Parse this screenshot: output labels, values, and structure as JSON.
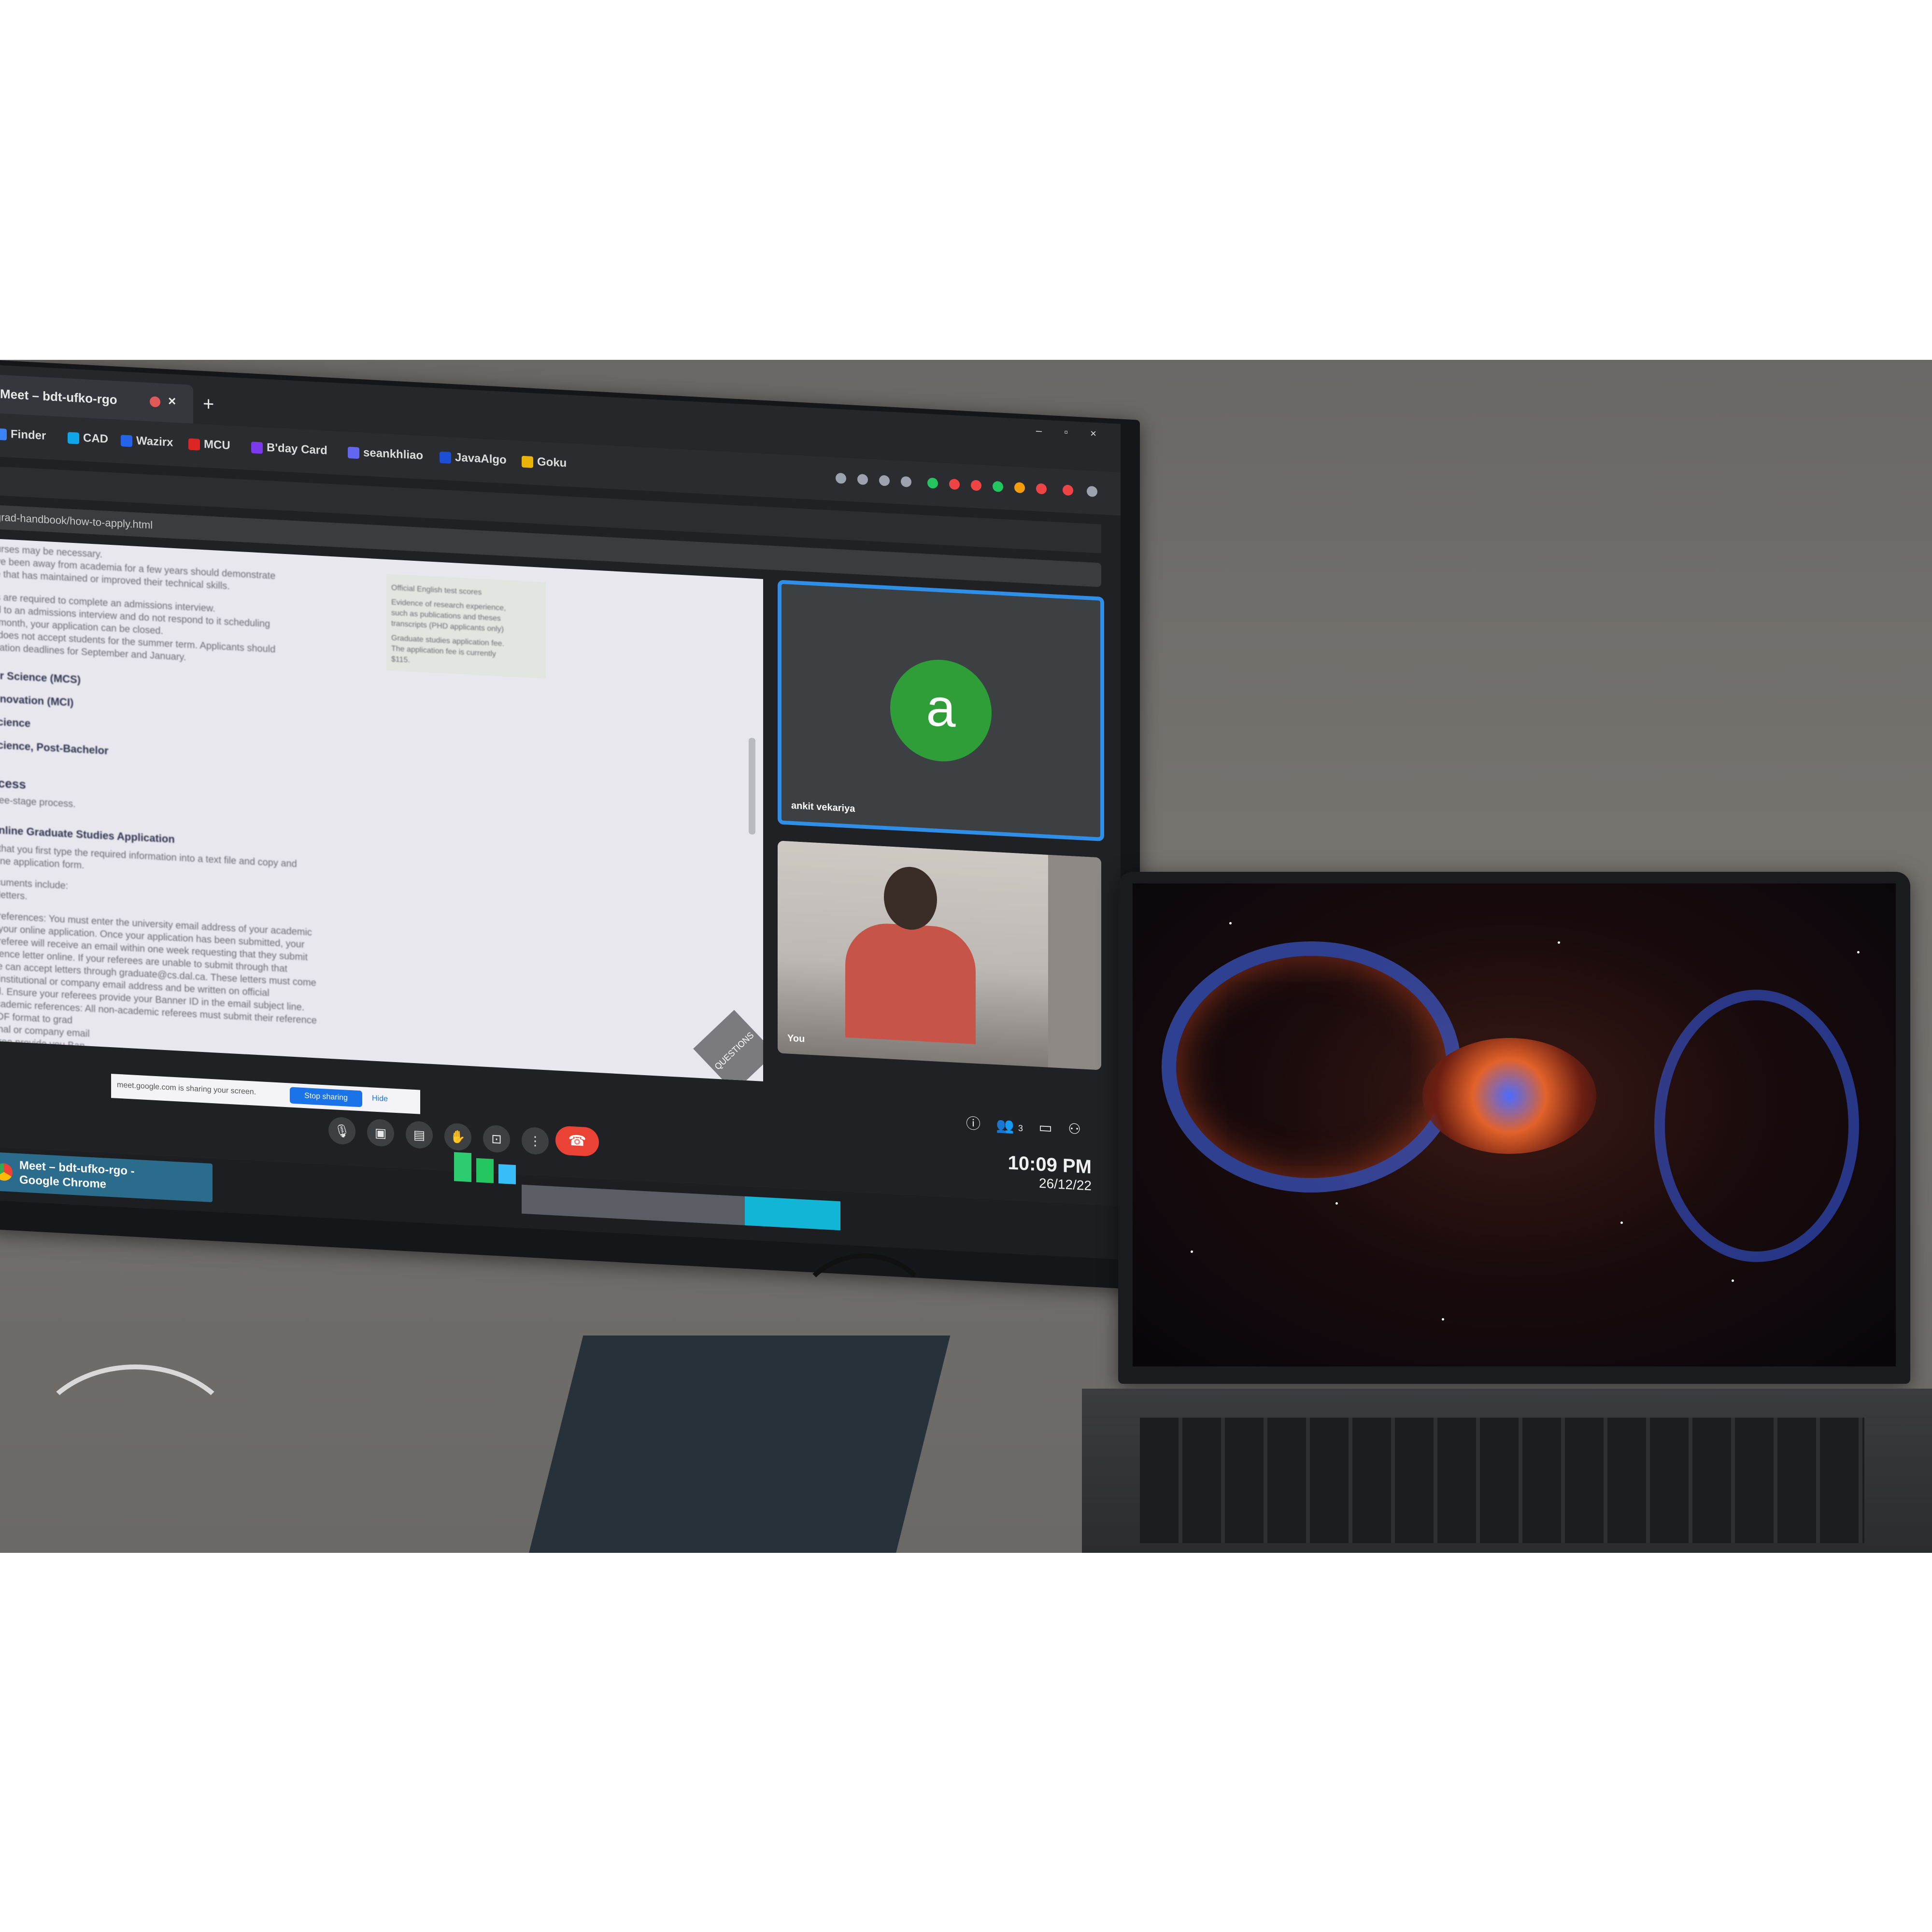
{
  "browser": {
    "tab_title": "Meet – bdt-ufko-rgo",
    "tab_close": "×",
    "new_tab": "+",
    "bookmarks": [
      {
        "label": "Finder",
        "color": "#3b82f6"
      },
      {
        "label": "CAD",
        "color": "#0ea5e9"
      },
      {
        "label": "Wazirx",
        "color": "#2563eb"
      },
      {
        "label": "MCU",
        "color": "#dc2626"
      },
      {
        "label": "B'day Card",
        "color": "#7c3aed"
      },
      {
        "label": "seankhliao",
        "color": "#6366f1"
      },
      {
        "label": "JavaAlgo",
        "color": "#1d4ed8"
      },
      {
        "label": "Goku",
        "color": "#eab308"
      }
    ],
    "extension_colors": [
      "#9ca3af",
      "#9ca3af",
      "#22c55e",
      "#ef4444",
      "#ef4444",
      "#22c55e",
      "#f59e0b",
      "#ef4444",
      "#9ca3af",
      "#ef4444"
    ],
    "window_controls": "–  ▫  ×"
  },
  "inner_browser": {
    "address": "grad-handbook/how-to-apply.html"
  },
  "document": {
    "lines": [
      "ourses may be necessary.",
      "ave been away from academia for a few years should demonstrate",
      "ce that has maintained or improved their technical skills.",
      "es are required to complete an admissions interview.",
      "ed to an admissions interview and do not respond to it scheduling",
      "1 month, your application can be closed.",
      "s does not accept students for the summer term. Applicants should",
      "lication deadlines for September and January."
    ],
    "headings": [
      "ter Science (MCS)",
      "Innovation (MCI)",
      "Science",
      "Science, Post-Bachelor",
      "ocess",
      "Online Graduate Studies Application"
    ],
    "body_lines": [
      "hree-stage process.",
      "d that you first type the required information into a text file and copy and",
      "nline application form.",
      "ocuments include:",
      "e letters.",
      "c references: You must enter the university email address of your academic",
      "n your online application. Once your application has been submitted, your",
      "c referee will receive an email within one week requesting that they submit",
      "erence letter online. If your referees are unable to submit through that",
      "we can accept letters through graduate@cs.dal.ca. These letters must come",
      "ir institutional or company email address and be written on official",
      "ad. Ensure your referees provide your Banner ID in the email subject line.",
      "academic references: All non-academic referees must submit their reference",
      "PDF format to grad",
      "ional or company email",
      "feree provide you Ban"
    ],
    "side_lines": [
      "Official English test scores",
      "Evidence of research experience,",
      "such as publications and theses",
      "transcripts (PHD applicants only)",
      "Graduate studies application fee.",
      "The application fee is currently",
      "$115."
    ],
    "questions_label": "QUESTIONS"
  },
  "share_bar": {
    "message": "meet.google.com is sharing your screen.",
    "stop": "Stop sharing",
    "hide": "Hide"
  },
  "meet": {
    "participant_initial": "a",
    "participant_name": "ankit vekariya",
    "self_label": "You",
    "avatar_color": "#2f9e39",
    "active_border_color": "#2f8fe8",
    "hangup_color": "#ea4335"
  },
  "controls": {
    "mic_icon": "🎙",
    "cam_icon": "▣",
    "captions_icon": "▤",
    "hand_icon": "✋",
    "present_icon": "⊡",
    "more_icon": "⋮",
    "hangup_icon": "☎",
    "info_icon": "ⓘ",
    "people_icon": "👥",
    "chat_icon": "▭",
    "activities_icon": "⚇",
    "people_count": "3"
  },
  "clock": {
    "time": "10:09 PM",
    "date": "26/12/22"
  },
  "taskbar": {
    "item_line1": "Meet – bdt-ufko-rgo -",
    "item_line2": "Google Chrome"
  }
}
